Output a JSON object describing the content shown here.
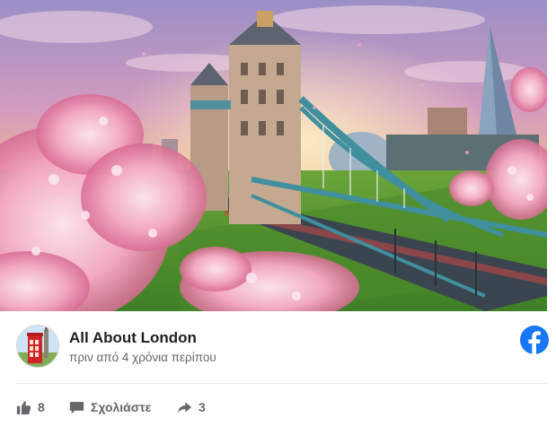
{
  "post": {
    "author_name": "All About London",
    "post_time": "πριν από 4 χρόνια περίπου",
    "image": {
      "subject": "tower-bridge-cherry-blossom"
    },
    "icons": {
      "avatar": "red-phone-box-avatar",
      "platform": "facebook-icon",
      "like": "thumbs-up-icon",
      "comment": "comment-bubble-icon",
      "share": "share-arrow-icon"
    },
    "actions": {
      "like_count": "8",
      "comment_label": "Σχολιάστε",
      "share_count": "3"
    }
  },
  "colors": {
    "facebook_blue": "#1877f2",
    "text_primary": "#1c1e21",
    "text_secondary": "#65676b",
    "divider": "#e4e6eb"
  }
}
